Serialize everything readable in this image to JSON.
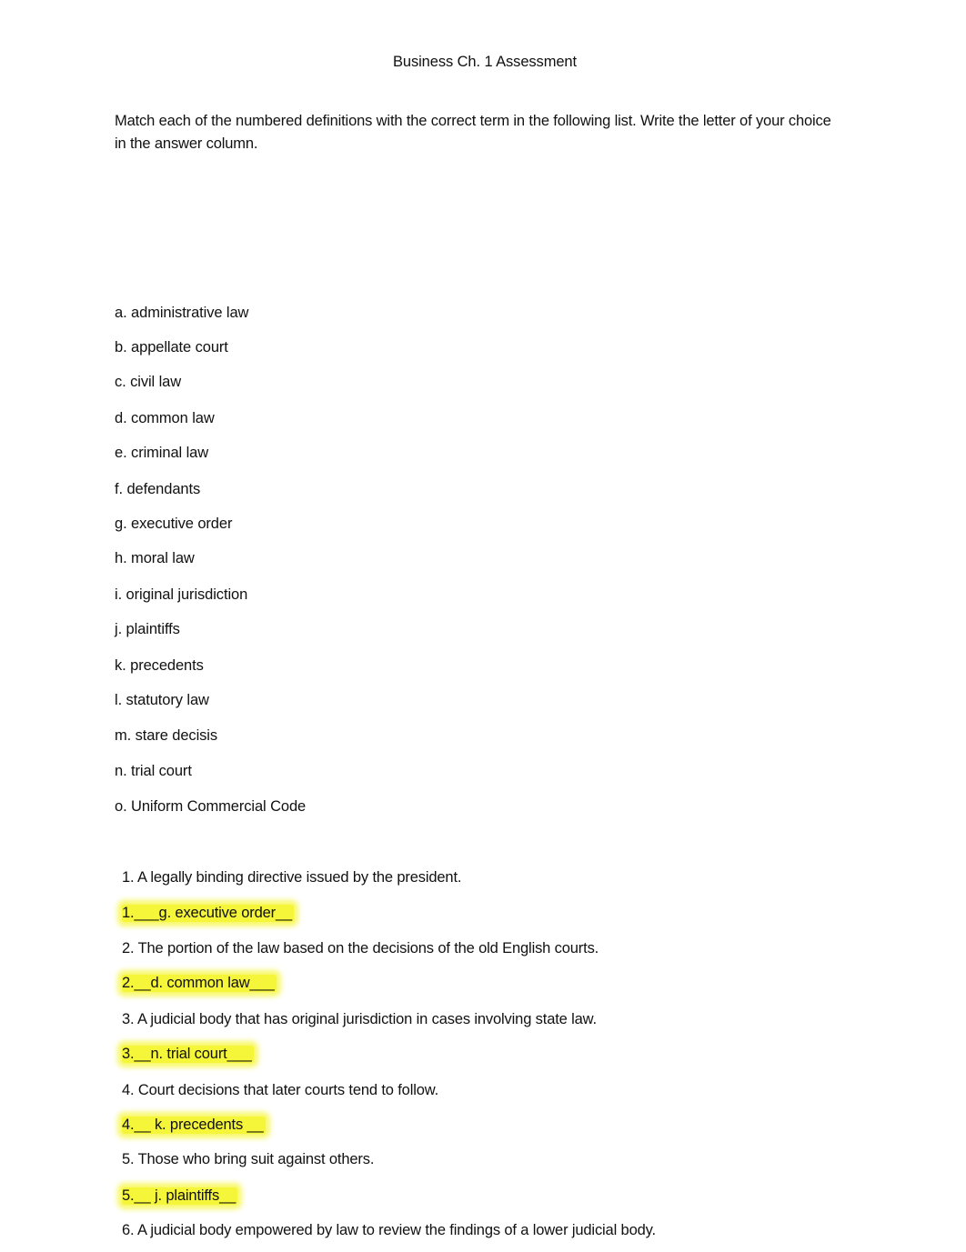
{
  "document": {
    "title": "Business Ch. 1 Assessment",
    "instructions": "Match each of the numbered definitions with the correct term in the following list. Write the letter of your choice in the answer column.",
    "highlight_color": "#f5f53a"
  },
  "terms": [
    "a. administrative law",
    "b. appellate court",
    "c. civil law",
    "d. common law",
    "e. criminal law",
    "f. defendants",
    "g. executive order",
    "h. moral law",
    "i. original jurisdiction",
    "j. plaintiffs",
    "k. precedents",
    "l. statutory law",
    "m. stare decisis",
    "n. trial court",
    "o. Uniform Commercial Code"
  ],
  "questions": [
    {
      "definition": "1. A legally binding directive issued by the president.",
      "answer": "1.___g. executive order__"
    },
    {
      "definition": "2. The portion of the law based on the decisions of the old English courts.",
      "answer": "2.__d. common law___"
    },
    {
      "definition": "3. A judicial body that has original jurisdiction in cases involving state law.",
      "answer": "3.__n. trial court___"
    },
    {
      "definition": "4. Court decisions that later courts tend to follow.",
      "answer": "4.__ k. precedents __"
    },
    {
      "definition": "5. Those who bring suit against others.",
      "answer": "5.__ j. plaintiffs__"
    },
    {
      "definition": "6. A judicial body empowered by law to review the findings of a lower judicial body."
    }
  ]
}
